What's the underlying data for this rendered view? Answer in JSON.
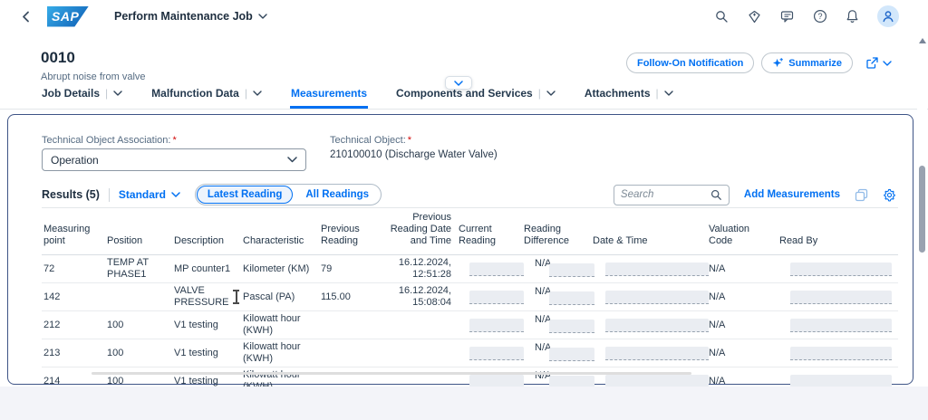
{
  "shell": {
    "app_title": "Perform Maintenance Job",
    "icons": [
      "back-icon",
      "sap-logo",
      "search-icon",
      "jewel-icon",
      "feedback-icon",
      "help-icon",
      "notifications-icon",
      "user-avatar"
    ]
  },
  "header": {
    "object_id": "0010",
    "object_desc": "Abrupt noise from valve",
    "follow_on_label": "Follow-On Notification",
    "summarize_label": "Summarize"
  },
  "tabs": [
    {
      "label": "Job Details",
      "has_menu": true,
      "selected": false
    },
    {
      "label": "Malfunction Data",
      "has_menu": true,
      "selected": false
    },
    {
      "label": "Measurements",
      "has_menu": false,
      "selected": true
    },
    {
      "label": "Components and Services",
      "has_menu": true,
      "selected": false
    },
    {
      "label": "Attachments",
      "has_menu": true,
      "selected": false
    }
  ],
  "form": {
    "required_marker": "*",
    "assoc_label": "Technical Object Association:",
    "assoc_value": "Operation",
    "object_label": "Technical Object:",
    "object_value": "210100010 (Discharge Water Valve)"
  },
  "toolbar": {
    "results_label": "Results (5)",
    "variant_label": "Standard",
    "segments": [
      "Latest Reading",
      "All Readings"
    ],
    "selected_segment": "Latest Reading",
    "search_placeholder": "Search",
    "add_label": "Add Measurements"
  },
  "table": {
    "columns": [
      "Measuring point",
      "Position",
      "Description",
      "Characteristic",
      "Previous Reading",
      "Previous Reading Date and Time",
      "Current Reading",
      "Reading Difference",
      "Date & Time",
      "Valuation Code",
      "Read By"
    ],
    "rows": [
      {
        "point": "72",
        "position": "TEMP AT PHASE1",
        "description": "MP counter1",
        "characteristic": "Kilometer (KM)",
        "previous_reading": "79",
        "previous_date": "16.12.2024, 12:51:28",
        "reading_difference": "N/A",
        "valuation_code": "N/A",
        "cursor": false
      },
      {
        "point": "142",
        "position": "",
        "description": "VALVE PRESSURE",
        "characteristic": "Pascal (PA)",
        "previous_reading": "115.00",
        "previous_date": "16.12.2024, 15:08:04",
        "reading_difference": "N/A",
        "valuation_code": "N/A",
        "cursor": true
      },
      {
        "point": "212",
        "position": "100",
        "description": "V1 testing",
        "characteristic": "Kilowatt hour (KWH)",
        "previous_reading": "",
        "previous_date": "",
        "reading_difference": "N/A",
        "valuation_code": "N/A",
        "cursor": false
      },
      {
        "point": "213",
        "position": "100",
        "description": "V1 testing",
        "characteristic": "Kilowatt hour (KWH)",
        "previous_reading": "",
        "previous_date": "",
        "reading_difference": "N/A",
        "valuation_code": "N/A",
        "cursor": false
      },
      {
        "point": "214",
        "position": "100",
        "description": "V1 testing",
        "characteristic": "Kilowatt hour (KWH)",
        "previous_reading": "",
        "previous_date": "",
        "reading_difference": "N/A",
        "valuation_code": "N/A",
        "cursor": false
      }
    ]
  }
}
